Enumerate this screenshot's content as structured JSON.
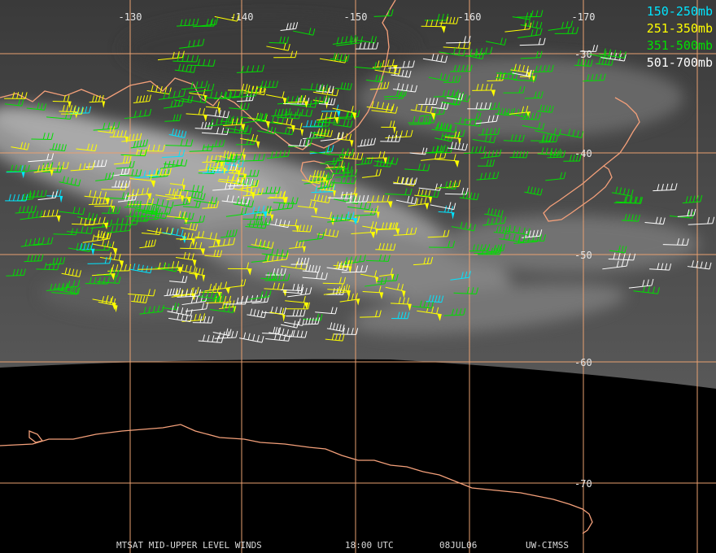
{
  "map": {
    "longitude_labels": [
      "-130",
      "-140",
      "-150",
      "-160",
      "-170"
    ],
    "latitude_labels": [
      "-30",
      "-40",
      "-50",
      "-60",
      "-70"
    ]
  },
  "legend": [
    {
      "label": "150-250mb",
      "color": "#00e5ff"
    },
    {
      "label": "251-350mb",
      "color": "#ffff00"
    },
    {
      "label": "351-500mb",
      "color": "#00e000"
    },
    {
      "label": "501-700mb",
      "color": "#ffffff"
    }
  ],
  "footer": {
    "product": "MTSAT MID-UPPER LEVEL WINDS",
    "time": "18:00 UTC",
    "date": "08JUL06",
    "source": "UW-CIMSS"
  },
  "colors": {
    "coastline": "#f4a07a",
    "gridline": "#e8a070",
    "space": "#000000"
  }
}
